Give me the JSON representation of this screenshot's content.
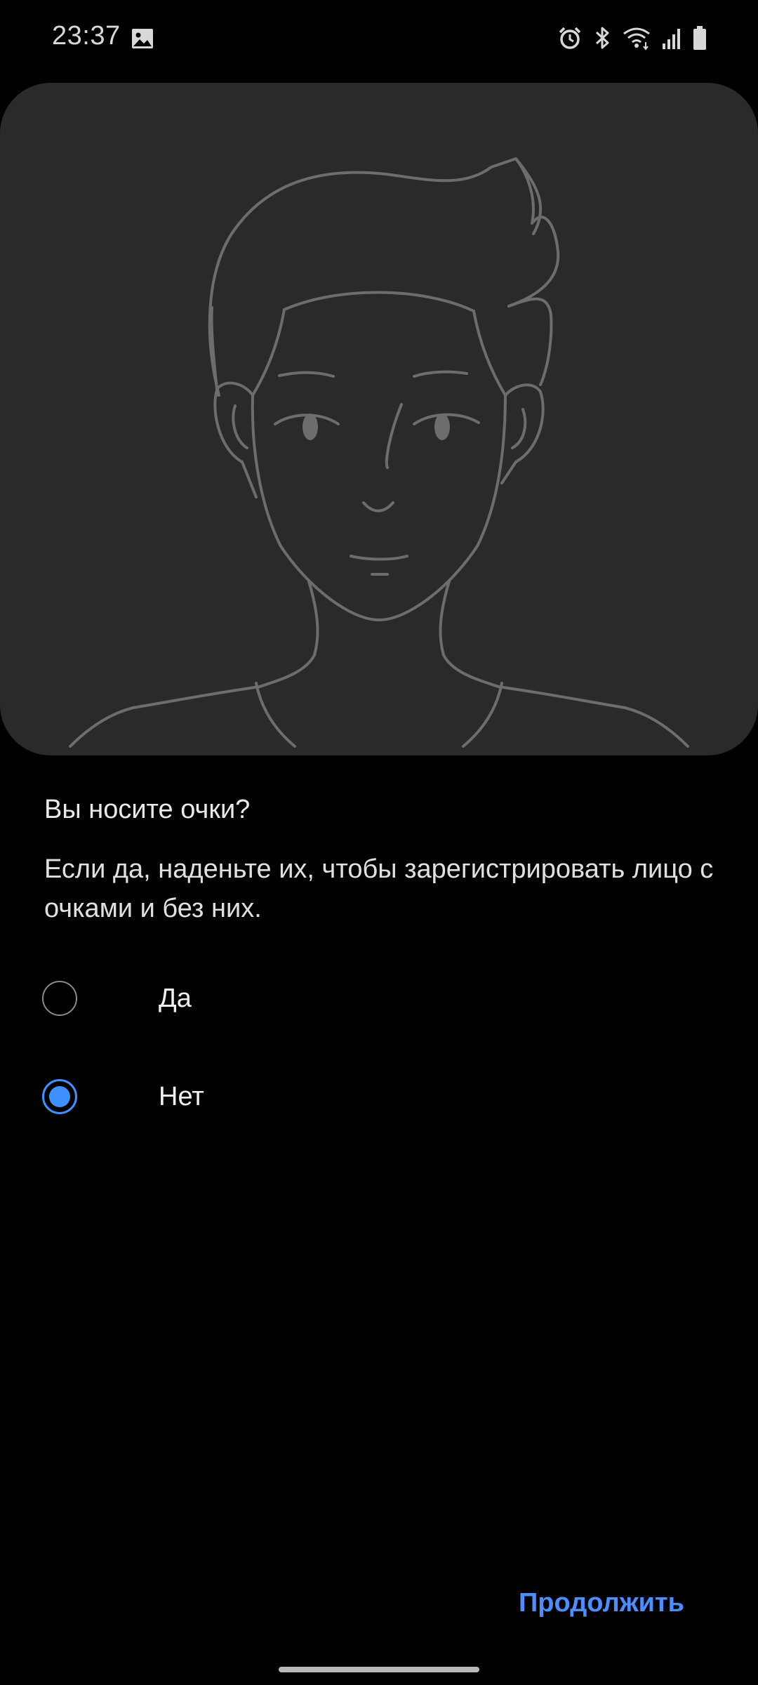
{
  "status_bar": {
    "time": "23:37",
    "left_icons": [
      "image-icon"
    ],
    "right_icons": [
      "alarm-icon",
      "bluetooth-icon",
      "wifi-icon",
      "signal-icon",
      "battery-icon"
    ]
  },
  "illustration": {
    "icon": "face-outline-icon"
  },
  "question": {
    "title": "Вы носите очки?",
    "description": "Если да, наденьте их, чтобы зарегистрировать лицо с очками и без них."
  },
  "options": [
    {
      "label": "Да",
      "selected": false
    },
    {
      "label": "Нет",
      "selected": true
    }
  ],
  "footer": {
    "continue_label": "Продолжить"
  },
  "colors": {
    "accent": "#3e91ff",
    "button_text": "#4c8dff",
    "card_background": "#2a2a2a",
    "background": "#000000"
  }
}
